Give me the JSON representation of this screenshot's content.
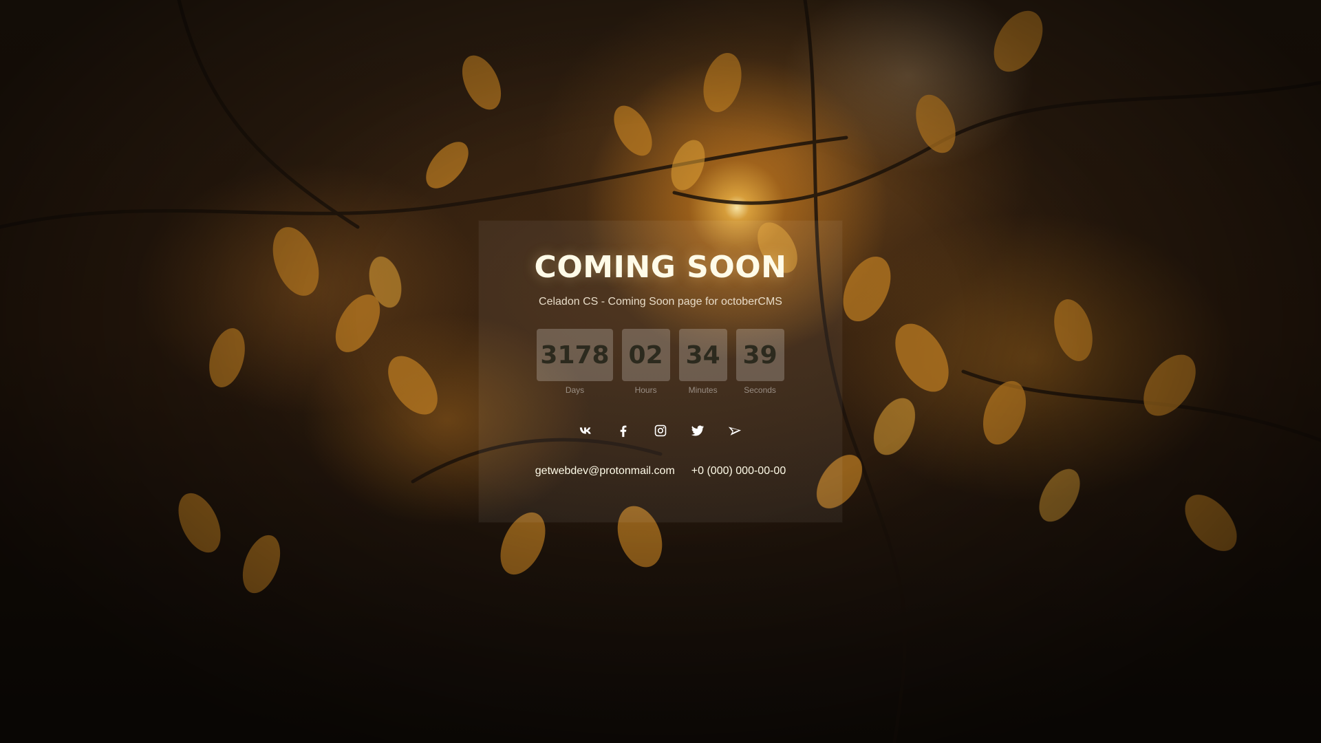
{
  "header": {
    "title": "COMING SOON",
    "subtitle": "Celadon CS - Coming Soon page for octoberCMS"
  },
  "countdown": {
    "days": "3178",
    "days_label": "Days",
    "hours": "02",
    "hours_label": "Hours",
    "minutes": "34",
    "minutes_label": "Minutes",
    "seconds": "39",
    "seconds_label": "Seconds"
  },
  "social": {
    "icons": [
      "vk-icon",
      "facebook-icon",
      "instagram-icon",
      "twitter-icon",
      "paper-plane-icon"
    ]
  },
  "contacts": {
    "email": "getwebdev@protonmail.com",
    "phone": "+0 (000) 000-00-00"
  },
  "colors": {
    "title": "#fffbe8",
    "countdown_digits": "#2c2a1e",
    "countdown_box": "rgba(255,255,255,0.22)"
  }
}
